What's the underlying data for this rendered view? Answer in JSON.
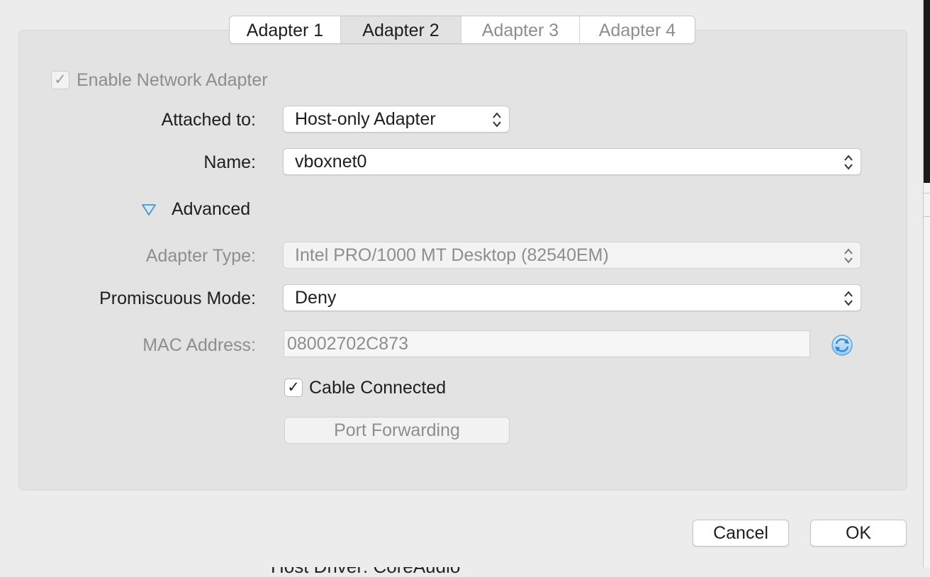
{
  "tabs": [
    {
      "label": "Adapter 1",
      "state": "enabled"
    },
    {
      "label": "Adapter 2",
      "state": "selected"
    },
    {
      "label": "Adapter 3",
      "state": "disabled"
    },
    {
      "label": "Adapter 4",
      "state": "disabled"
    }
  ],
  "enable_adapter": {
    "label": "Enable Network Adapter",
    "checked": true,
    "disabled": true
  },
  "attached_to": {
    "label": "Attached to:",
    "value": "Host-only Adapter"
  },
  "name": {
    "label": "Name:",
    "value": "vboxnet0"
  },
  "advanced": {
    "label": "Advanced",
    "expanded": true
  },
  "adapter_type": {
    "label": "Adapter Type:",
    "value": "Intel PRO/1000 MT Desktop (82540EM)",
    "disabled": true
  },
  "promiscuous_mode": {
    "label": "Promiscuous Mode:",
    "value": "Deny"
  },
  "mac_address": {
    "label": "MAC Address:",
    "value": "08002702C873",
    "disabled": true
  },
  "cable_connected": {
    "label": "Cable Connected",
    "checked": true
  },
  "port_forwarding": {
    "label": "Port Forwarding",
    "disabled": true
  },
  "buttons": {
    "cancel": "Cancel",
    "ok": "OK"
  },
  "background": {
    "partial_text": "Host Driver:  CoreAudio"
  },
  "colors": {
    "accent": "#3b9ae1",
    "disabled_text": "#8e8e8e",
    "panel": "#e3e3e3"
  }
}
